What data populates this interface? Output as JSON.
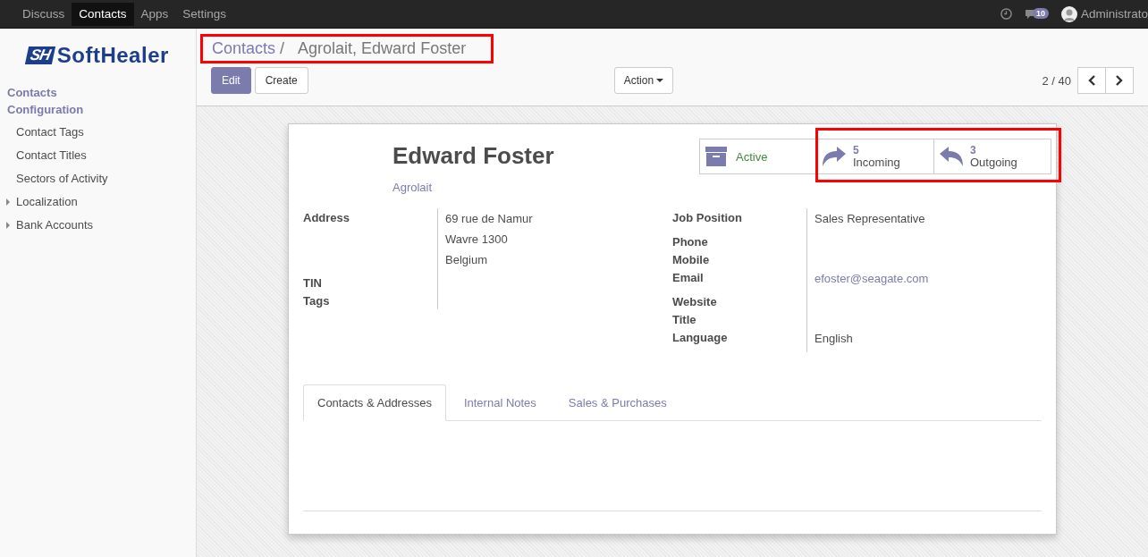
{
  "top_menu": [
    {
      "label": "Discuss",
      "selected": false
    },
    {
      "label": "Contacts",
      "selected": true
    },
    {
      "label": "Apps",
      "selected": false
    },
    {
      "label": "Settings",
      "selected": false
    }
  ],
  "systray": {
    "message_count": "10",
    "user": "Administrato"
  },
  "sidebar": {
    "logo": {
      "mark": "SH",
      "name": "SoftHealer"
    },
    "sections": [
      {
        "title": "Contacts"
      },
      {
        "title": "Configuration",
        "items": [
          {
            "label": "Contact Tags",
            "expandable": false
          },
          {
            "label": "Contact Titles",
            "expandable": false
          },
          {
            "label": "Sectors of Activity",
            "expandable": false
          },
          {
            "label": "Localization",
            "expandable": true
          },
          {
            "label": "Bank Accounts",
            "expandable": true
          }
        ]
      }
    ]
  },
  "breadcrumb": {
    "items": [
      "Contacts",
      "Agrolait, Edward Foster"
    ],
    "separator": "/"
  },
  "buttons": [
    {
      "label": "Edit",
      "kind": "primary"
    },
    {
      "label": "Create",
      "kind": "default"
    }
  ],
  "action": "Action",
  "pager": "2 / 40",
  "card": {
    "name": "Edward Foster",
    "company": "Agrolait",
    "stat_buttons": [
      {
        "kind": "archive",
        "label": "Active"
      },
      {
        "kind": "incoming",
        "count": "5",
        "label": "Incoming"
      },
      {
        "kind": "outgoing",
        "count": "3",
        "label": "Outgoing"
      }
    ],
    "left_fields": [
      {
        "label": "Address",
        "values": [
          "69 rue de Namur",
          "Wavre 1300",
          "Belgium"
        ]
      },
      {
        "label": "TIN"
      },
      {
        "label": "Tags"
      }
    ],
    "right_fields": [
      {
        "label": "Job Position",
        "values": [
          "Sales Representative"
        ]
      },
      {
        "label": "Phone"
      },
      {
        "label": "Mobile"
      },
      {
        "label": "Email",
        "values": [
          "efoster@seagate.com"
        ],
        "kind": "link"
      },
      {
        "label": "Website"
      },
      {
        "label": "Title"
      },
      {
        "label": "Language",
        "values": [
          "English"
        ]
      }
    ],
    "tabs": [
      {
        "label": "Contacts & Addresses",
        "selected": true
      },
      {
        "label": "Internal Notes",
        "selected": false
      },
      {
        "label": "Sales & Purchases",
        "selected": false
      }
    ]
  }
}
